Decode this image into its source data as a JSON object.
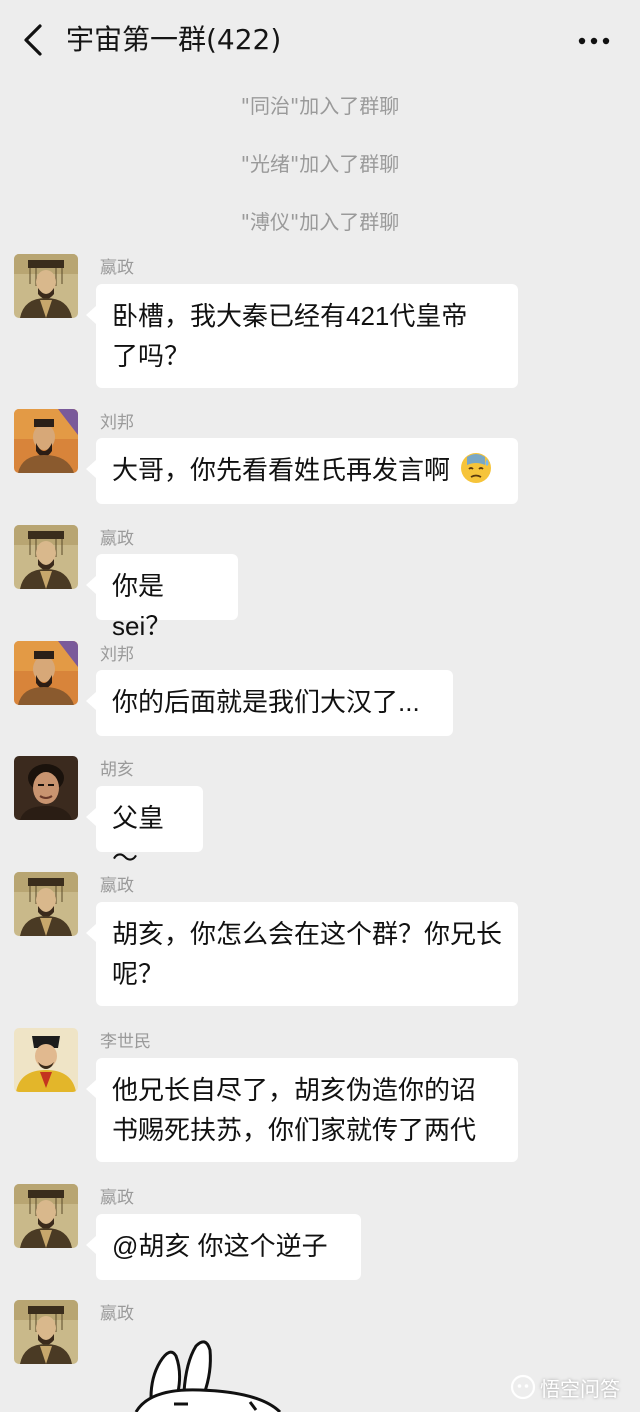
{
  "header": {
    "title": "宇宙第一群(422)",
    "back_icon": "chevron-left-icon",
    "more_icon": "more-dots-icon"
  },
  "system_messages": [
    "\"同治\"加入了群聊",
    "\"光绪\"加入了群聊",
    "\"溥仪\"加入了群聊"
  ],
  "messages": [
    {
      "sender": "嬴政",
      "lines": [
        "卧槽，我大秦已经有421代皇帝",
        "了吗？"
      ]
    },
    {
      "sender": "刘邦",
      "lines": [
        "大哥，你先看看姓氏再发言啊"
      ],
      "emoji": "sweat-face-icon"
    },
    {
      "sender": "嬴政",
      "lines": [
        "你是sei？"
      ]
    },
    {
      "sender": "刘邦",
      "lines": [
        "你的后面就是我们大汉了..."
      ]
    },
    {
      "sender": "胡亥",
      "lines": [
        "父皇～"
      ]
    },
    {
      "sender": "嬴政",
      "lines": [
        "胡亥，你怎么会在这个群？你兄长",
        "呢？"
      ]
    },
    {
      "sender": "李世民",
      "lines": [
        "他兄长自尽了，胡亥伪造你的诏",
        "书赐死扶苏，你们家就传了两代"
      ]
    },
    {
      "sender": "嬴政",
      "lines": [
        "@胡亥  你这个逆子"
      ]
    },
    {
      "sender": "嬴政",
      "sticker": "rabbit-sticker"
    }
  ],
  "watermark": {
    "text": "悟空问答"
  },
  "colors": {
    "background": "#ededed",
    "bubble": "#ffffff",
    "system_text": "#9a9a9a"
  }
}
